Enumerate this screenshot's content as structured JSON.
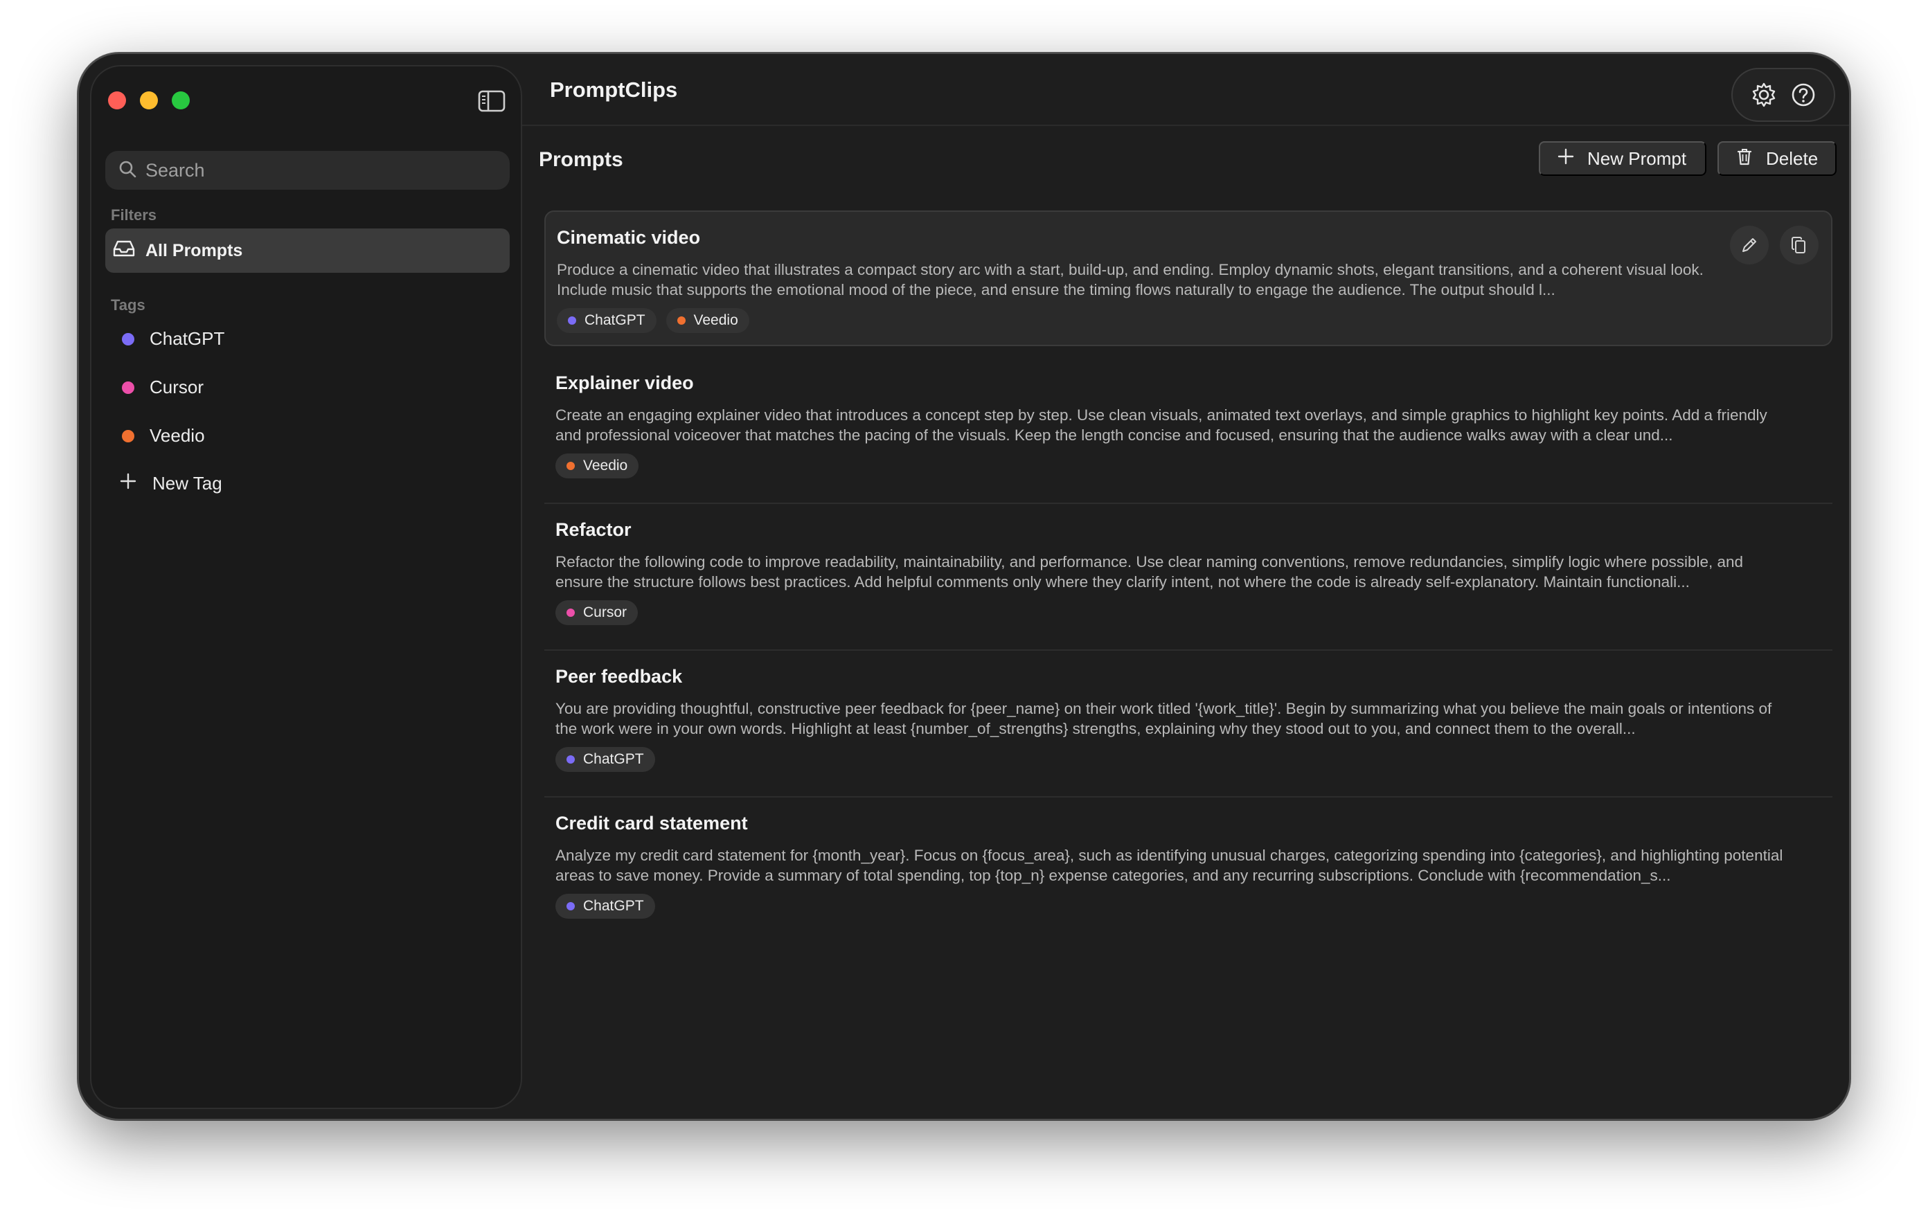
{
  "app": {
    "title": "PromptClips"
  },
  "sidebar": {
    "search_placeholder": "Search",
    "filters_label": "Filters",
    "all_prompts_label": "All Prompts",
    "tags_label": "Tags",
    "tags": [
      {
        "label": "ChatGPT",
        "color": "#7b6cf6"
      },
      {
        "label": "Cursor",
        "color": "#ec4fa9"
      },
      {
        "label": "Veedio",
        "color": "#f07030"
      }
    ],
    "new_tag_label": "New Tag"
  },
  "main": {
    "section_title": "Prompts",
    "new_prompt_label": "New Prompt",
    "delete_label": "Delete",
    "prompts": [
      {
        "title": "Cinematic video",
        "body": "Produce a cinematic video that illustrates a compact story arc with a start, build-up, and ending. Employ dynamic shots, elegant transitions, and a coherent visual look. Include music that supports the emotional mood of the piece, and ensure the timing flows naturally to engage the audience. The output should l...",
        "tags": [
          {
            "label": "ChatGPT",
            "color": "#7b6cf6"
          },
          {
            "label": "Veedio",
            "color": "#f07030"
          }
        ]
      },
      {
        "title": "Explainer video",
        "body": "Create an engaging explainer video that introduces a concept step by step. Use clean visuals, animated text overlays, and simple graphics to highlight key points. Add a friendly and professional voiceover that matches the pacing of the visuals. Keep the length concise and focused, ensuring that the audience walks away with a clear und...",
        "tags": [
          {
            "label": "Veedio",
            "color": "#f07030"
          }
        ]
      },
      {
        "title": "Refactor",
        "body": "Refactor the following code to improve readability, maintainability, and performance. Use clear naming conventions, remove redundancies, simplify logic where possible, and ensure the structure follows best practices. Add helpful comments only where they clarify intent, not where the code is already self-explanatory. Maintain functionali...",
        "tags": [
          {
            "label": "Cursor",
            "color": "#ec4fa9"
          }
        ]
      },
      {
        "title": "Peer feedback",
        "body": "You are providing thoughtful, constructive peer feedback for {peer_name} on their work titled '{work_title}'. Begin by summarizing what you believe the main goals or intentions of the work were in your own words. Highlight at least {number_of_strengths} strengths, explaining why they stood out to you, and connect them to the overall...",
        "tags": [
          {
            "label": "ChatGPT",
            "color": "#7b6cf6"
          }
        ]
      },
      {
        "title": "Credit card statement",
        "body": "Analyze my credit card statement for {month_year}. Focus on {focus_area}, such as identifying unusual charges, categorizing spending into {categories}, and highlighting potential areas to save money. Provide a summary of total spending, top {top_n} expense categories, and any recurring subscriptions. Conclude with {recommendation_s...",
        "tags": [
          {
            "label": "ChatGPT",
            "color": "#7b6cf6"
          }
        ]
      }
    ]
  }
}
